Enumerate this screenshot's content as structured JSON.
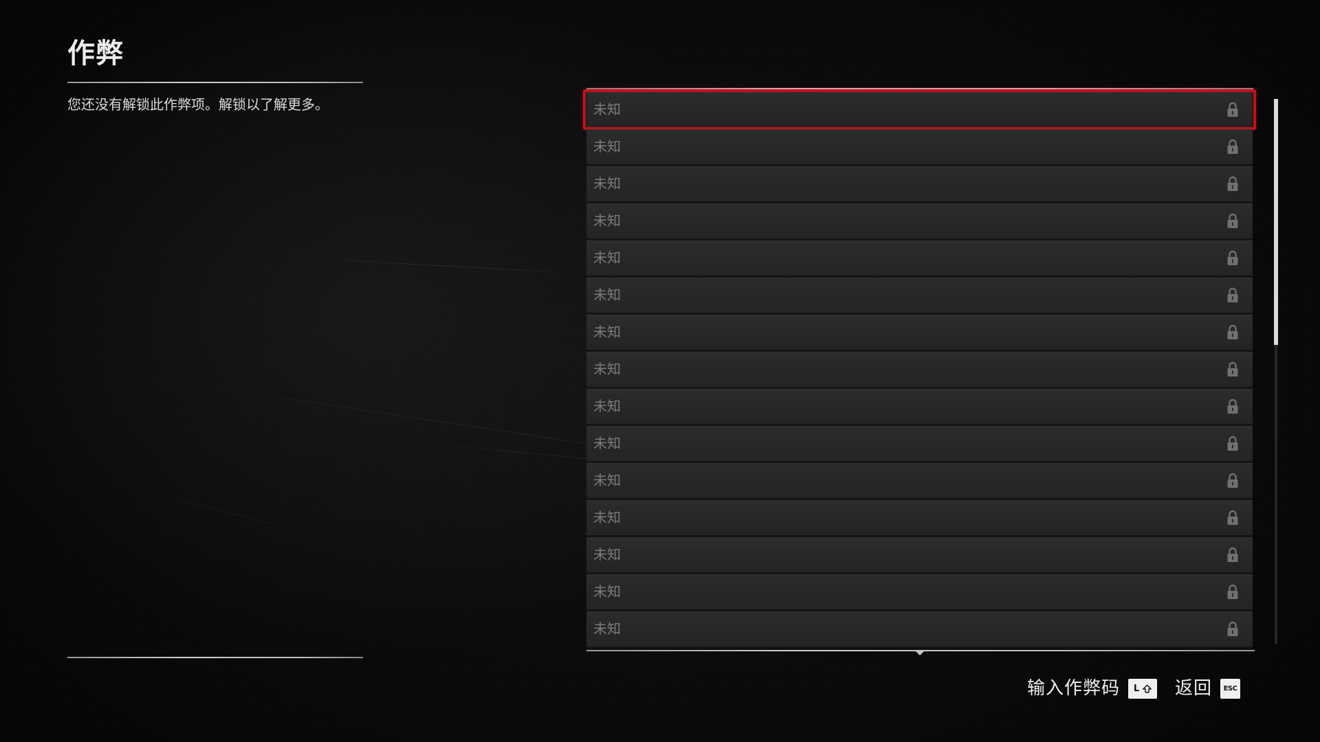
{
  "header": {
    "title": "作弊",
    "description": "您还没有解锁此作弊项。解锁以了解更多。"
  },
  "cheats": {
    "selected_index": 0,
    "items": [
      {
        "label": "未知",
        "locked": true,
        "icon": "lock-icon"
      },
      {
        "label": "未知",
        "locked": true,
        "icon": "lock-icon"
      },
      {
        "label": "未知",
        "locked": true,
        "icon": "lock-icon"
      },
      {
        "label": "未知",
        "locked": true,
        "icon": "lock-icon"
      },
      {
        "label": "未知",
        "locked": true,
        "icon": "lock-icon"
      },
      {
        "label": "未知",
        "locked": true,
        "icon": "lock-icon"
      },
      {
        "label": "未知",
        "locked": true,
        "icon": "lock-icon"
      },
      {
        "label": "未知",
        "locked": true,
        "icon": "lock-icon"
      },
      {
        "label": "未知",
        "locked": true,
        "icon": "lock-icon"
      },
      {
        "label": "未知",
        "locked": true,
        "icon": "lock-icon"
      },
      {
        "label": "未知",
        "locked": true,
        "icon": "lock-icon"
      },
      {
        "label": "未知",
        "locked": true,
        "icon": "lock-icon"
      },
      {
        "label": "未知",
        "locked": true,
        "icon": "lock-icon"
      },
      {
        "label": "未知",
        "locked": true,
        "icon": "lock-icon"
      },
      {
        "label": "未知",
        "locked": true,
        "icon": "lock-icon"
      }
    ]
  },
  "footer": {
    "enter_code": {
      "label": "输入作弊码",
      "key": "L",
      "key_icon": "shift-icon"
    },
    "back": {
      "label": "返回",
      "key": "ESC"
    }
  },
  "icons": {
    "more_below": "chevron-down-icon"
  },
  "colors": {
    "background": "#0b0b0b",
    "row": "#282828",
    "row_text": "#7c7c7c",
    "selection_border": "#c4111b",
    "text": "#e6e6e6",
    "key_bg": "#f0f0f0"
  }
}
